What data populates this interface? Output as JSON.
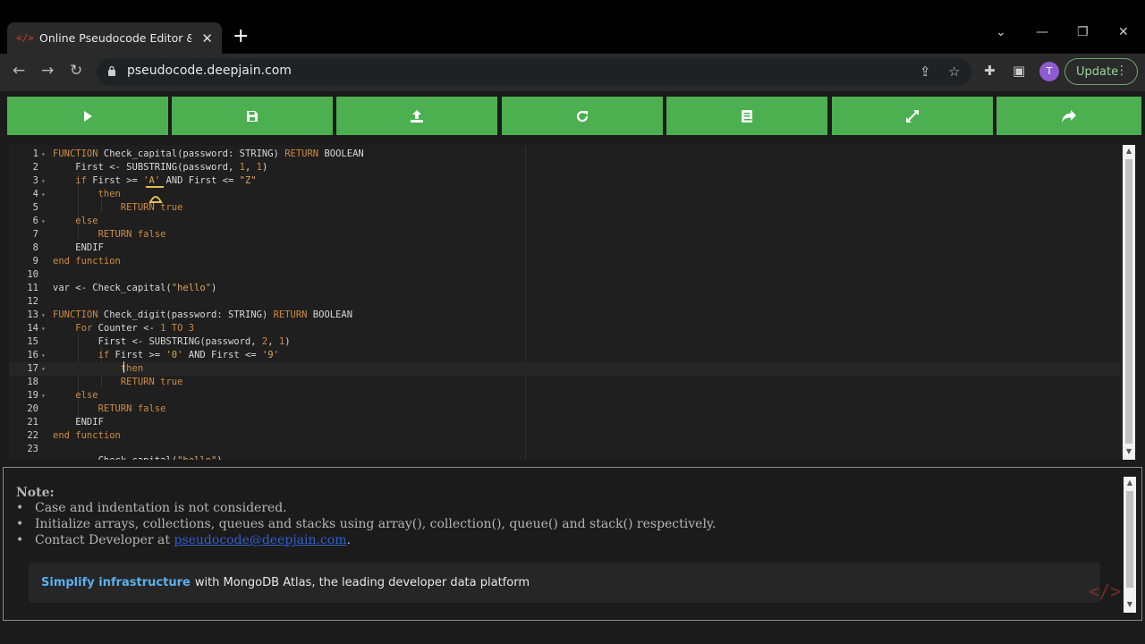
{
  "browser": {
    "tab_title": "Online Pseudocode Editor & Compiler",
    "favicon_text": "</>",
    "new_tab_label": "+",
    "url": "pseudocode.deepjain.com",
    "avatar_letter": "T",
    "update_label": "Update"
  },
  "toolbar_buttons": [
    {
      "name": "run-button",
      "icon": "play-icon"
    },
    {
      "name": "save-button",
      "icon": "save-icon"
    },
    {
      "name": "upload-button",
      "icon": "upload-icon"
    },
    {
      "name": "reset-button",
      "icon": "refresh-icon"
    },
    {
      "name": "docs-button",
      "icon": "book-icon"
    },
    {
      "name": "fullscreen-button",
      "icon": "expand-icon"
    },
    {
      "name": "share-button",
      "icon": "share-icon"
    }
  ],
  "editor": {
    "lines": [
      {
        "n": "1",
        "fold": true
      },
      {
        "n": "2"
      },
      {
        "n": "3",
        "fold": true
      },
      {
        "n": "4",
        "fold": true
      },
      {
        "n": "5"
      },
      {
        "n": "6",
        "fold": true
      },
      {
        "n": "7"
      },
      {
        "n": "8"
      },
      {
        "n": "9"
      },
      {
        "n": "10"
      },
      {
        "n": "11"
      },
      {
        "n": "12"
      },
      {
        "n": "13",
        "fold": true
      },
      {
        "n": "14",
        "fold": true
      },
      {
        "n": "15"
      },
      {
        "n": "16",
        "fold": true
      },
      {
        "n": "17",
        "fold": true
      },
      {
        "n": "18"
      },
      {
        "n": "19",
        "fold": true
      },
      {
        "n": "20"
      },
      {
        "n": "21"
      },
      {
        "n": "22"
      },
      {
        "n": "23"
      }
    ],
    "code": [
      "FUNCTION Check_capital(password: STRING) RETURN BOOLEAN",
      "    First <- SUBSTRING(password, 1, 1)",
      "    if First >= 'A' AND First <= \"Z\"",
      "        then",
      "            RETURN true",
      "    else",
      "        RETURN false",
      "    ENDIF",
      "end function",
      "",
      "var <- Check_capital(\"hello\")",
      "",
      "FUNCTION Check_digit(password: STRING) RETURN BOOLEAN",
      "    For Counter <- 1 TO 3",
      "        First <- SUBSTRING(password, 2, 1)",
      "        if First >= '0' AND First <= '9'",
      "            then",
      "            RETURN true",
      "    else",
      "        RETURN false",
      "    ENDIF",
      "end function",
      "",
      "        Check_capital(\"hello\")"
    ]
  },
  "note": {
    "title": "Note:",
    "items": [
      "Case and indentation is not considered.",
      "Initialize arrays, collections, queues and stacks using array(), collection(), queue() and stack() respectively."
    ],
    "contact_prefix": "Contact Developer at",
    "contact_email": "pseudocode@deepjain.com",
    "contact_suffix": "."
  },
  "ad": {
    "highlight": "Simplify infrastructure",
    "text": "with MongoDB Atlas, the leading developer data platform"
  },
  "colors": {
    "button_green": "#4caf50",
    "keyword": "#d08a3f",
    "link": "#2f5fd0",
    "ad_highlight": "#5ab0f0"
  }
}
